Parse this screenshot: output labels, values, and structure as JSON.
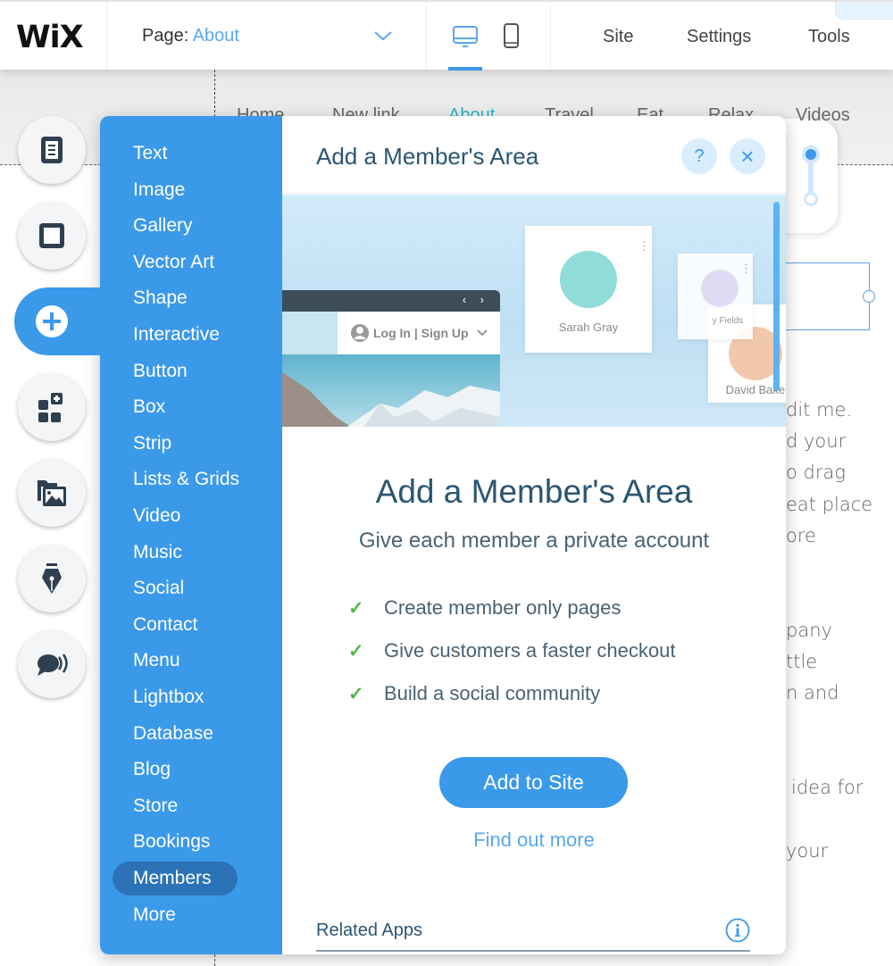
{
  "topbar": {
    "logo": "WiX",
    "page_label": "Page:",
    "page_value": "About",
    "page_dropdown_icon": "chevron-down-icon",
    "devices": [
      {
        "name": "desktop",
        "icon": "desktop-icon",
        "active": true
      },
      {
        "name": "mobile",
        "icon": "mobile-icon",
        "active": false
      }
    ],
    "menu": [
      "Site",
      "Settings",
      "Tools"
    ]
  },
  "site_nav": [
    "Home",
    "New link",
    "About",
    "Travel",
    "Eat",
    "Relax",
    "Videos"
  ],
  "site_nav_active": "About",
  "background_text_fragments": [
    "dit me.",
    "d your",
    "o drag",
    "eat place",
    "ore",
    "pany",
    "ttle",
    "n and",
    "idea for",
    "your"
  ],
  "left_rail": [
    {
      "name": "menus-pages",
      "icon": "pages-icon",
      "active": false
    },
    {
      "name": "background",
      "icon": "background-icon",
      "active": false
    },
    {
      "name": "add",
      "icon": "plus-icon",
      "active": true
    },
    {
      "name": "add-apps",
      "icon": "apps-icon",
      "active": false
    },
    {
      "name": "media",
      "icon": "media-icon",
      "active": false
    },
    {
      "name": "blog",
      "icon": "pen-icon",
      "active": false
    },
    {
      "name": "ascend",
      "icon": "chat-icon",
      "active": false
    }
  ],
  "add_panel": {
    "categories": [
      "Text",
      "Image",
      "Gallery",
      "Vector Art",
      "Shape",
      "Interactive",
      "Button",
      "Box",
      "Strip",
      "Lists & Grids",
      "Video",
      "Music",
      "Social",
      "Contact",
      "Menu",
      "Lightbox",
      "Database",
      "Blog",
      "Store",
      "Bookings",
      "Members",
      "More"
    ],
    "selected_category": "Members",
    "header_title": "Add a Member's Area",
    "help_icon": "?",
    "close_icon": "×",
    "hero": {
      "login_text": "Log In | Sign Up",
      "members": [
        "Sarah Gray",
        "David Baker",
        "y Fields"
      ]
    },
    "title": "Add a Member's Area",
    "subtitle": "Give each member a private account",
    "features": [
      "Create member only pages",
      "Give customers a faster checkout",
      "Build a social community"
    ],
    "check_glyph": "✓",
    "primary_button": "Add to Site",
    "secondary_link": "Find out more",
    "related_label": "Related Apps"
  },
  "colors": {
    "accent": "#3b99ea",
    "selected_category": "#2b73b6",
    "heading": "#2b5672",
    "check": "#50b748",
    "link": "#5aa7ee"
  }
}
